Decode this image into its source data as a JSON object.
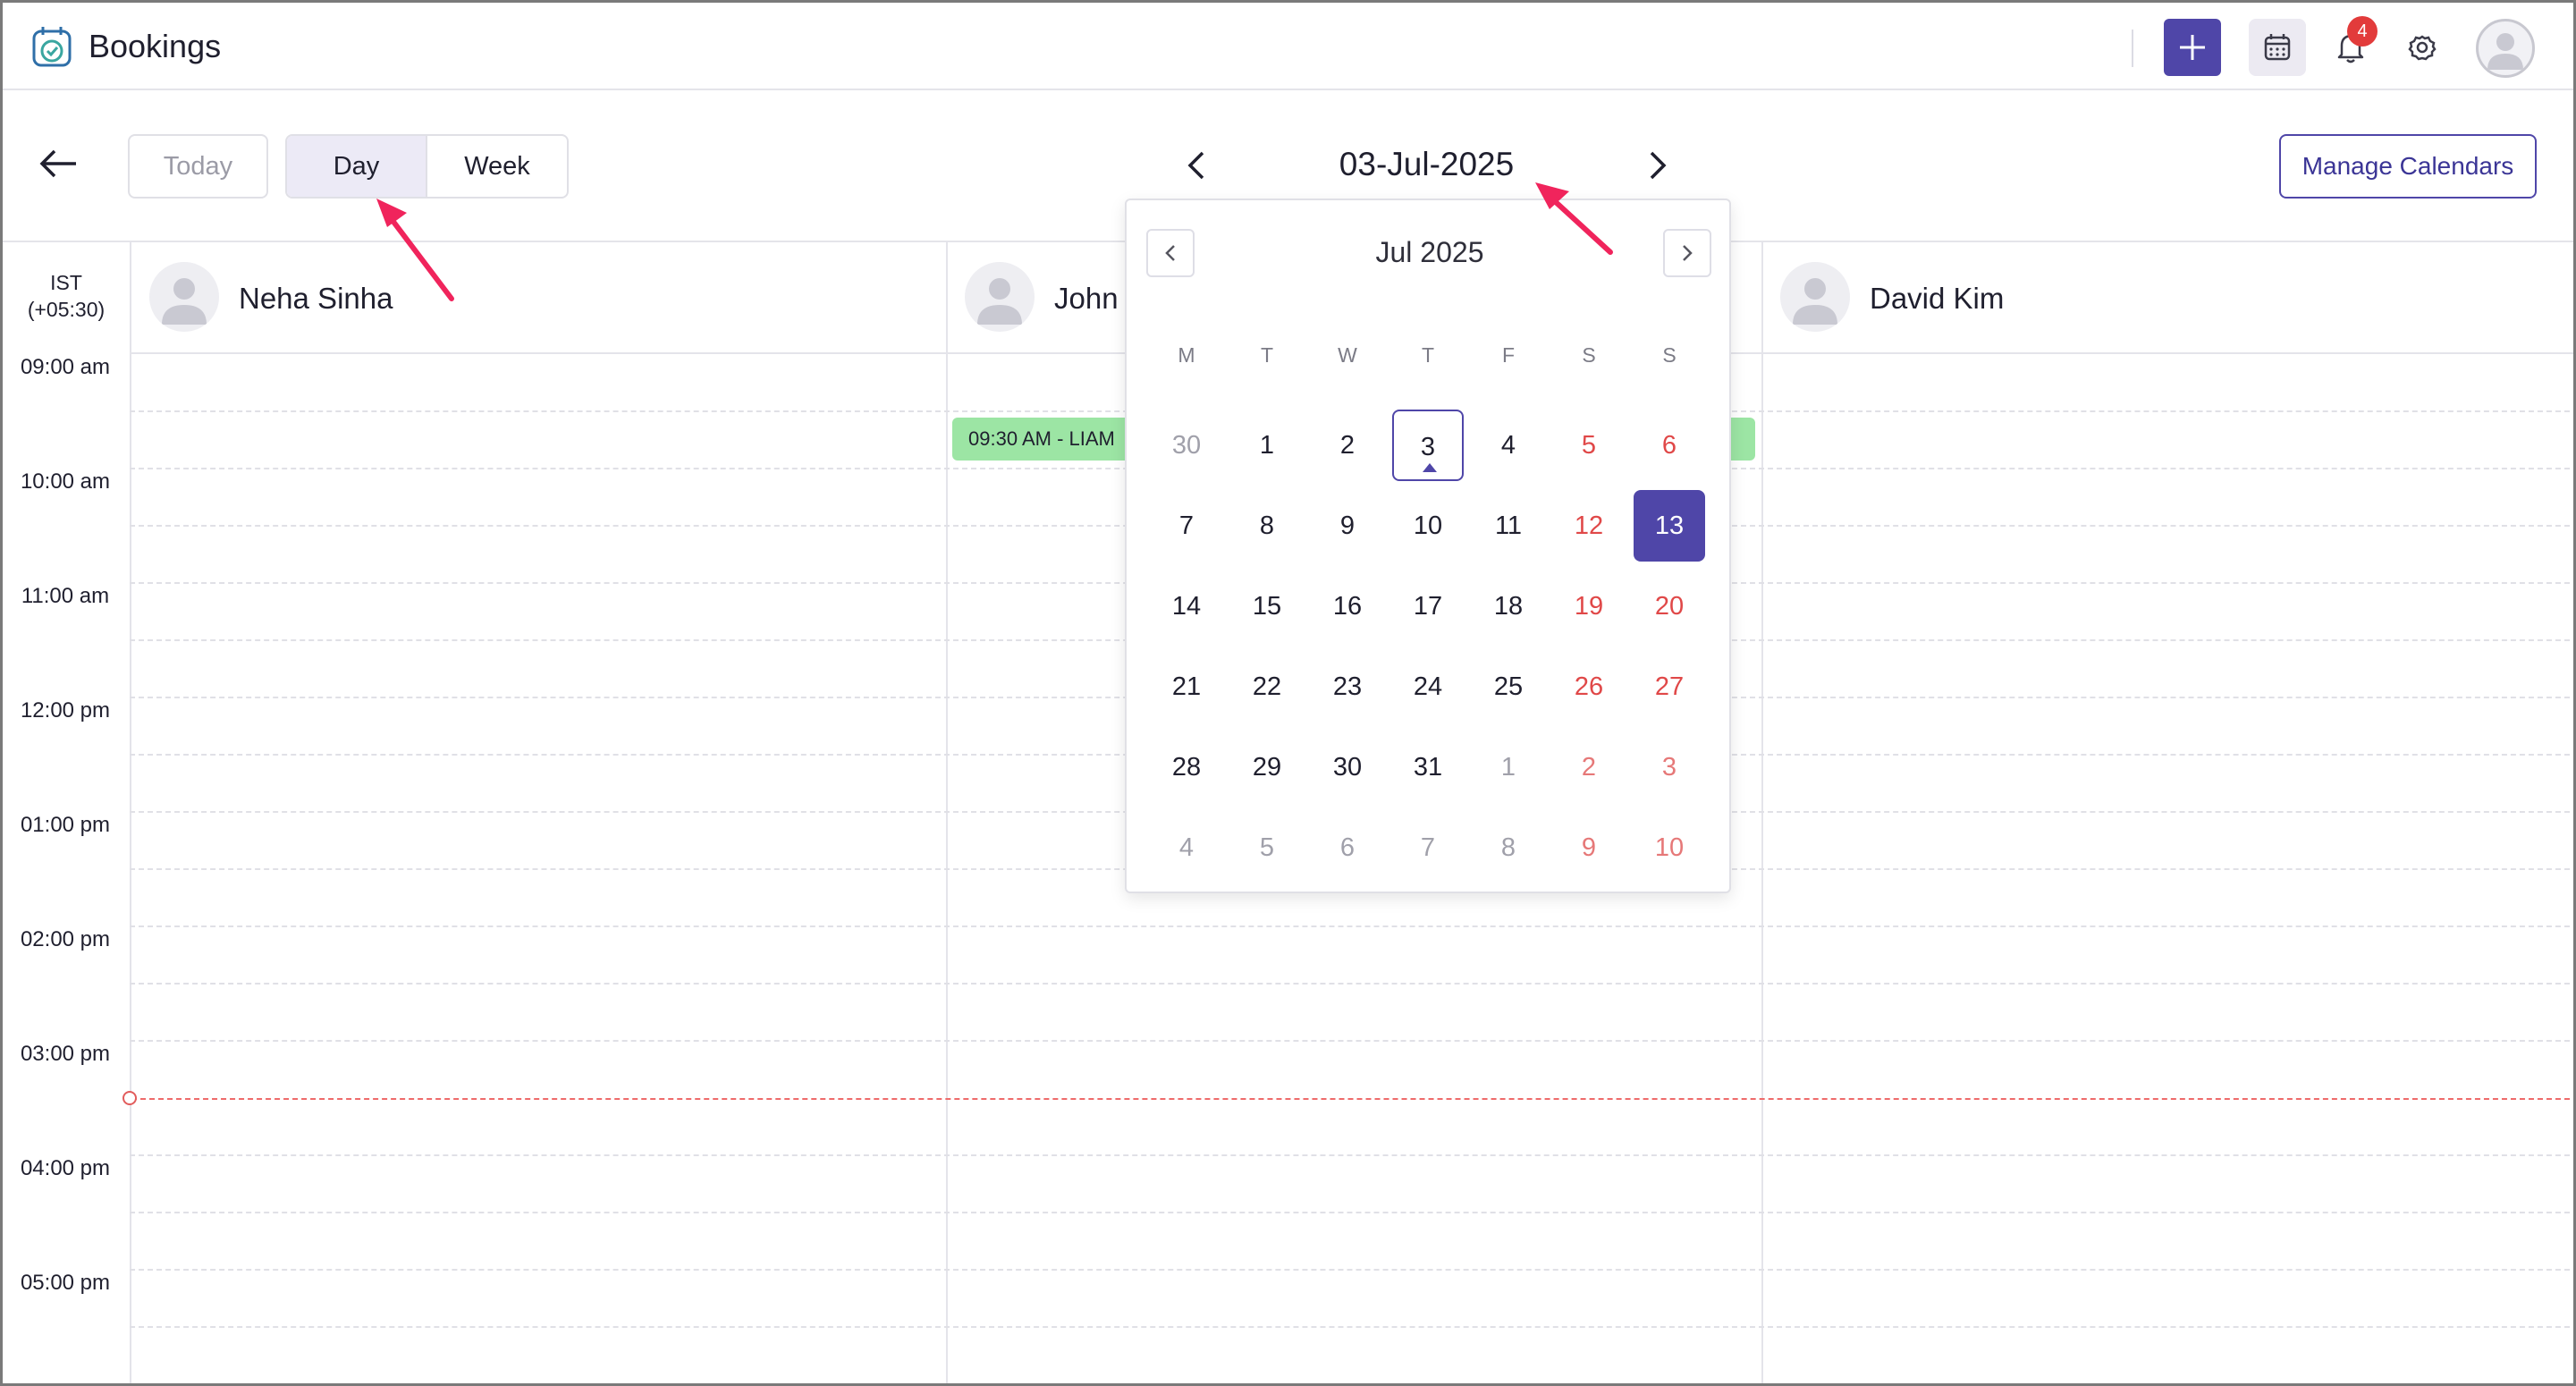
{
  "app": {
    "title": "Bookings",
    "notifications_count": "4"
  },
  "toolbar": {
    "today_label": "Today",
    "day_label": "Day",
    "week_label": "Week",
    "current_date": "03-Jul-2025",
    "manage_label": "Manage Calendars"
  },
  "timezone": {
    "name": "IST",
    "offset": "(+05:30)"
  },
  "resources": [
    {
      "name": "Neha Sinha"
    },
    {
      "name": "John"
    },
    {
      "name": "David Kim"
    }
  ],
  "time_slots": [
    "09:00 am",
    "10:00 am",
    "11:00 am",
    "12:00 pm",
    "01:00 pm",
    "02:00 pm",
    "03:00 pm",
    "04:00 pm",
    "05:00 pm"
  ],
  "event": {
    "label": "09:30 AM - LIAM",
    "color": "#9ce5a4"
  },
  "picker": {
    "title": "Jul 2025",
    "weekdays": [
      "M",
      "T",
      "W",
      "T",
      "F",
      "S",
      "S"
    ],
    "weeks": [
      [
        "30",
        "1",
        "2",
        "3",
        "4",
        "5",
        "6"
      ],
      [
        "7",
        "8",
        "9",
        "10",
        "11",
        "12",
        "13"
      ],
      [
        "14",
        "15",
        "16",
        "17",
        "18",
        "19",
        "20"
      ],
      [
        "21",
        "22",
        "23",
        "24",
        "25",
        "26",
        "27"
      ],
      [
        "28",
        "29",
        "30",
        "31",
        "1",
        "2",
        "3"
      ],
      [
        "4",
        "5",
        "6",
        "7",
        "8",
        "9",
        "10"
      ]
    ],
    "today_day": "3",
    "selected_day": "13"
  },
  "colors": {
    "accent": "#4f46a8",
    "weekend": "#e04848",
    "now_line": "#ee6b6b",
    "annotation": "#f0245c"
  },
  "icons": [
    "app-logo-icon",
    "plus-icon",
    "calendar-icon",
    "bell-icon",
    "gear-icon",
    "user-avatar-icon",
    "back-arrow-icon",
    "chevron-left-icon",
    "chevron-right-icon"
  ]
}
